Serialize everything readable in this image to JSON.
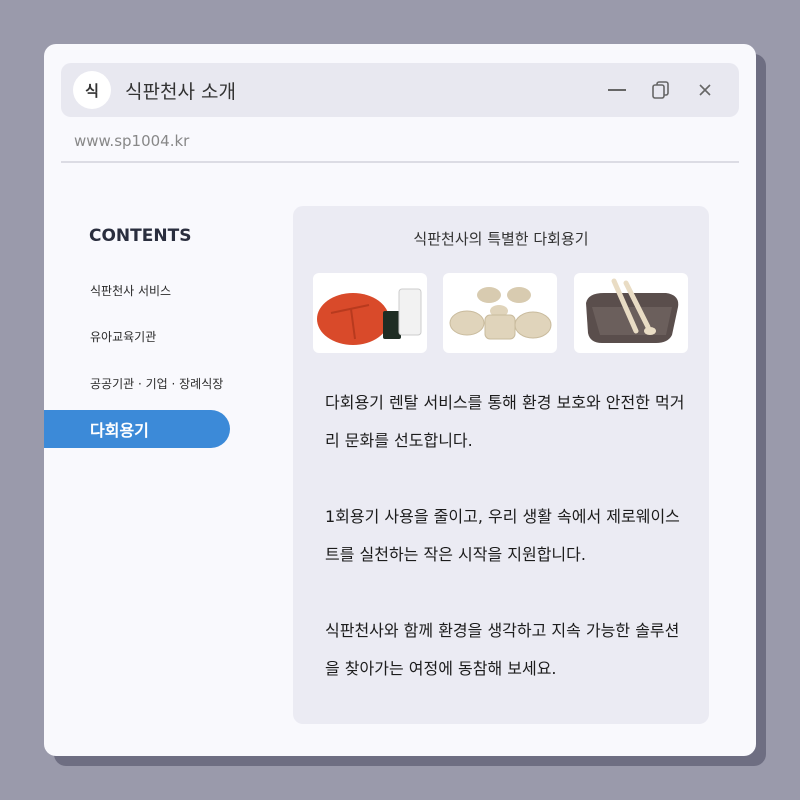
{
  "window": {
    "app_icon_text": "식",
    "title": "식판천사 소개",
    "url": "www.sp1004.kr"
  },
  "sidebar": {
    "heading": "CONTENTS",
    "items": [
      {
        "label": "식판천사 서비스"
      },
      {
        "label": "유아교육기관"
      },
      {
        "label": "공공기관 · 기업 · 장례식장"
      },
      {
        "label": "다회용기",
        "active": true
      }
    ]
  },
  "panel": {
    "title": "식판천사의 특별한 다회용기",
    "images": [
      {
        "name": "red-tray-and-cups-image"
      },
      {
        "name": "beige-dish-set-image"
      },
      {
        "name": "gray-tray-with-utensils-image"
      }
    ],
    "paragraphs": [
      "다회용기 렌탈 서비스를 통해 환경 보호와 안전한 먹거리 문화를 선도합니다.",
      "1회용기 사용을 줄이고, 우리 생활 속에서 제로웨이스트를 실천하는 작은 시작을 지원합니다.",
      "식판천사와 함께 환경을 생각하고 지속 가능한 솔루션을 찾아가는 여정에 동참해 보세요."
    ]
  },
  "colors": {
    "accent": "#3c8ad8",
    "background": "#9a9aab",
    "window": "#f9f9fd",
    "panel": "#ebebf3"
  }
}
